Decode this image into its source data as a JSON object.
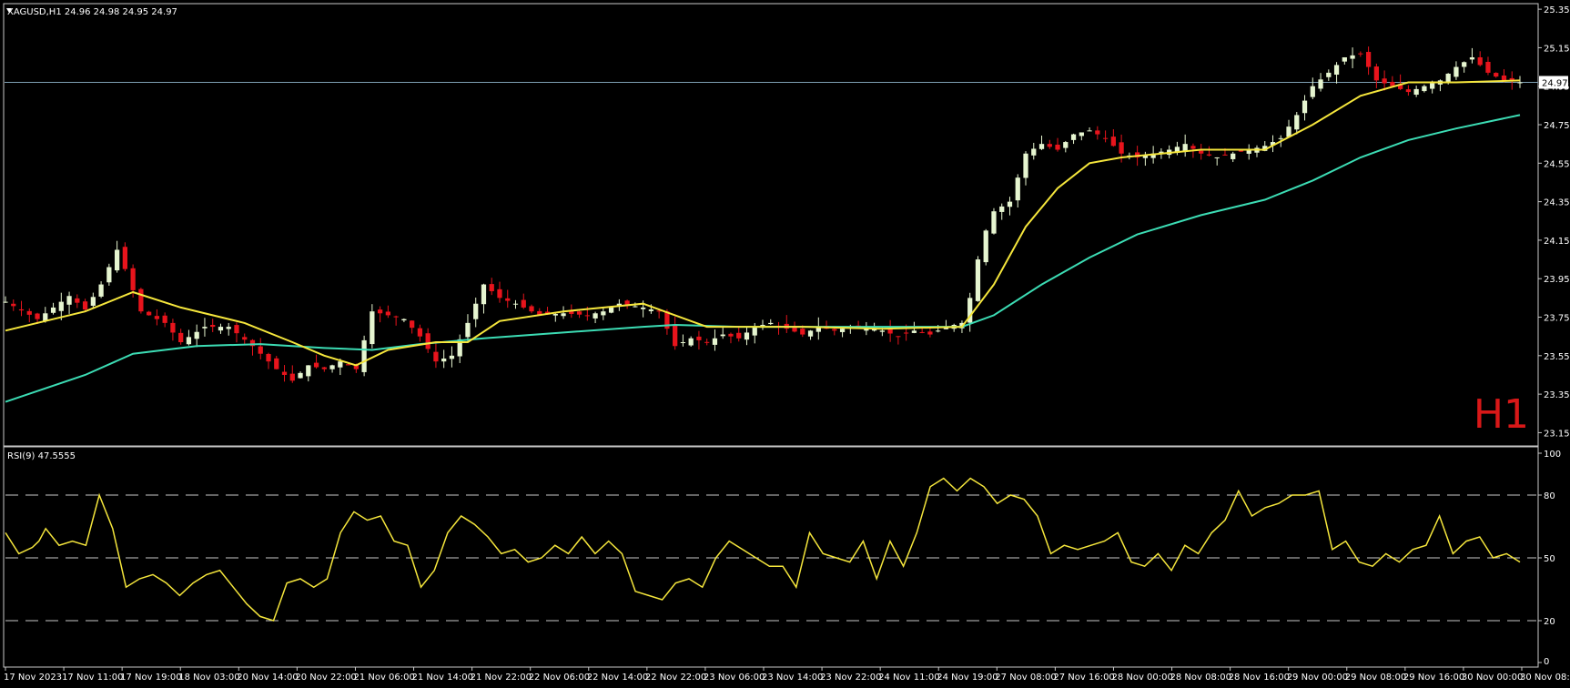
{
  "header": {
    "symbol_line": "XAGUSD,H1  24.96 24.98 24.95 24.97",
    "timeframe_watermark": "H1"
  },
  "colors": {
    "background": "#000000",
    "frame": "#c8c8c8",
    "bull_candle": "#e6f5d0",
    "bear_candle": "#e8141c",
    "ma_fast": "#f5e63c",
    "ma_slow": "#3cdcb4",
    "rsi_line": "#f5e63c",
    "last_price_line": "#7f9fb4"
  },
  "chart_data": [
    {
      "type": "candlestick",
      "symbol": "XAGUSD",
      "timeframe": "H1",
      "last_price_label": "24.97",
      "ylim": [
        23.1,
        25.36
      ],
      "y_ticks": [
        "25.35",
        "25.15",
        "24.95",
        "24.75",
        "24.55",
        "24.35",
        "24.15",
        "23.95",
        "23.75",
        "23.55",
        "23.35",
        "23.15"
      ],
      "x_ticks": [
        "17 Nov 2023",
        "17 Nov 11:00",
        "17 Nov 19:00",
        "18 Nov 03:00",
        "20 Nov 14:00",
        "20 Nov 22:00",
        "21 Nov 06:00",
        "21 Nov 14:00",
        "21 Nov 22:00",
        "22 Nov 06:00",
        "22 Nov 14:00",
        "22 Nov 22:00",
        "23 Nov 06:00",
        "23 Nov 14:00",
        "23 Nov 22:00",
        "24 Nov 11:00",
        "24 Nov 19:00",
        "27 Nov 08:00",
        "27 Nov 16:00",
        "28 Nov 00:00",
        "28 Nov 08:00",
        "28 Nov 16:00",
        "29 Nov 00:00",
        "29 Nov 08:00",
        "29 Nov 16:00",
        "30 Nov 00:00",
        "30 Nov 08:00"
      ],
      "close_path": [
        [
          0,
          23.83
        ],
        [
          4,
          23.74
        ],
        [
          6,
          23.8
        ],
        [
          8,
          23.86
        ],
        [
          10,
          23.79
        ],
        [
          12,
          23.92
        ],
        [
          14,
          24.1
        ],
        [
          15,
          24.0
        ],
        [
          17,
          23.78
        ],
        [
          20,
          23.72
        ],
        [
          22,
          23.62
        ],
        [
          25,
          23.7
        ],
        [
          28,
          23.7
        ],
        [
          31,
          23.6
        ],
        [
          34,
          23.48
        ],
        [
          36,
          23.42
        ],
        [
          38,
          23.5
        ],
        [
          40,
          23.48
        ],
        [
          42,
          23.52
        ],
        [
          44,
          23.48
        ],
        [
          46,
          23.78
        ],
        [
          48,
          23.76
        ],
        [
          50,
          23.74
        ],
        [
          52,
          23.65
        ],
        [
          54,
          23.52
        ],
        [
          56,
          23.55
        ],
        [
          58,
          23.72
        ],
        [
          60,
          23.92
        ],
        [
          62,
          23.85
        ],
        [
          64,
          23.82
        ],
        [
          67,
          23.76
        ],
        [
          70,
          23.77
        ],
        [
          73,
          23.76
        ],
        [
          75,
          23.78
        ],
        [
          77,
          23.82
        ],
        [
          80,
          23.8
        ],
        [
          82,
          23.78
        ],
        [
          84,
          23.6
        ],
        [
          86,
          23.64
        ],
        [
          88,
          23.62
        ],
        [
          90,
          23.66
        ],
        [
          92,
          23.64
        ],
        [
          94,
          23.7
        ],
        [
          96,
          23.72
        ],
        [
          98,
          23.69
        ],
        [
          100,
          23.66
        ],
        [
          102,
          23.7
        ],
        [
          104,
          23.68
        ],
        [
          106,
          23.7
        ],
        [
          108,
          23.7
        ],
        [
          110,
          23.68
        ],
        [
          112,
          23.65
        ],
        [
          114,
          23.68
        ],
        [
          116,
          23.66
        ],
        [
          118,
          23.7
        ],
        [
          120,
          23.72
        ],
        [
          121,
          23.85
        ],
        [
          122,
          24.05
        ],
        [
          123,
          24.2
        ],
        [
          124,
          24.3
        ],
        [
          126,
          24.35
        ],
        [
          128,
          24.6
        ],
        [
          130,
          24.65
        ],
        [
          132,
          24.62
        ],
        [
          134,
          24.7
        ],
        [
          136,
          24.72
        ],
        [
          138,
          24.68
        ],
        [
          140,
          24.6
        ],
        [
          142,
          24.58
        ],
        [
          144,
          24.6
        ],
        [
          146,
          24.62
        ],
        [
          148,
          24.65
        ],
        [
          150,
          24.6
        ],
        [
          152,
          24.58
        ],
        [
          154,
          24.6
        ],
        [
          156,
          24.62
        ],
        [
          158,
          24.64
        ],
        [
          160,
          24.68
        ],
        [
          162,
          24.8
        ],
        [
          164,
          24.95
        ],
        [
          166,
          25.02
        ],
        [
          168,
          25.1
        ],
        [
          170,
          25.12
        ],
        [
          172,
          24.98
        ],
        [
          174,
          24.95
        ],
        [
          176,
          24.92
        ],
        [
          178,
          24.95
        ],
        [
          180,
          24.98
        ],
        [
          182,
          25.05
        ],
        [
          184,
          25.1
        ],
        [
          186,
          25.02
        ],
        [
          188,
          24.98
        ],
        [
          190,
          24.97
        ]
      ],
      "ma_fast_path": [
        [
          0,
          23.68
        ],
        [
          10,
          23.78
        ],
        [
          16,
          23.88
        ],
        [
          22,
          23.8
        ],
        [
          30,
          23.72
        ],
        [
          36,
          23.62
        ],
        [
          40,
          23.55
        ],
        [
          44,
          23.5
        ],
        [
          48,
          23.58
        ],
        [
          54,
          23.62
        ],
        [
          58,
          23.62
        ],
        [
          62,
          23.73
        ],
        [
          70,
          23.78
        ],
        [
          80,
          23.82
        ],
        [
          84,
          23.76
        ],
        [
          88,
          23.7
        ],
        [
          100,
          23.7
        ],
        [
          110,
          23.69
        ],
        [
          120,
          23.7
        ],
        [
          124,
          23.92
        ],
        [
          128,
          24.22
        ],
        [
          132,
          24.42
        ],
        [
          136,
          24.55
        ],
        [
          140,
          24.58
        ],
        [
          150,
          24.62
        ],
        [
          158,
          24.62
        ],
        [
          164,
          24.75
        ],
        [
          170,
          24.9
        ],
        [
          176,
          24.97
        ],
        [
          182,
          24.97
        ],
        [
          190,
          24.98
        ]
      ],
      "ma_slow_path": [
        [
          0,
          23.31
        ],
        [
          10,
          23.45
        ],
        [
          16,
          23.56
        ],
        [
          24,
          23.6
        ],
        [
          32,
          23.61
        ],
        [
          40,
          23.59
        ],
        [
          46,
          23.58
        ],
        [
          52,
          23.61
        ],
        [
          60,
          23.64
        ],
        [
          70,
          23.67
        ],
        [
          80,
          23.7
        ],
        [
          84,
          23.71
        ],
        [
          92,
          23.7
        ],
        [
          100,
          23.7
        ],
        [
          110,
          23.7
        ],
        [
          120,
          23.7
        ],
        [
          124,
          23.76
        ],
        [
          130,
          23.92
        ],
        [
          136,
          24.06
        ],
        [
          142,
          24.18
        ],
        [
          150,
          24.28
        ],
        [
          158,
          24.36
        ],
        [
          164,
          24.46
        ],
        [
          170,
          24.58
        ],
        [
          176,
          24.67
        ],
        [
          182,
          24.73
        ],
        [
          190,
          24.8
        ]
      ]
    },
    {
      "type": "line",
      "indicator_label": "RSI(9) 47.5555",
      "ylim": [
        0,
        100
      ],
      "y_ticks": [
        "100",
        "80",
        "50",
        "20",
        "0"
      ],
      "levels": [
        80,
        50,
        20
      ],
      "values_path": [
        [
          0,
          62
        ],
        [
          2,
          52
        ],
        [
          4,
          55
        ],
        [
          5,
          58
        ],
        [
          6,
          64
        ],
        [
          8,
          56
        ],
        [
          10,
          58
        ],
        [
          12,
          56
        ],
        [
          14,
          80
        ],
        [
          16,
          64
        ],
        [
          18,
          36
        ],
        [
          20,
          40
        ],
        [
          22,
          42
        ],
        [
          24,
          38
        ],
        [
          26,
          32
        ],
        [
          28,
          38
        ],
        [
          30,
          42
        ],
        [
          32,
          44
        ],
        [
          34,
          36
        ],
        [
          36,
          28
        ],
        [
          38,
          22
        ],
        [
          40,
          20
        ],
        [
          42,
          38
        ],
        [
          44,
          40
        ],
        [
          46,
          36
        ],
        [
          48,
          40
        ],
        [
          50,
          62
        ],
        [
          52,
          72
        ],
        [
          54,
          68
        ],
        [
          56,
          70
        ],
        [
          58,
          58
        ],
        [
          60,
          56
        ],
        [
          62,
          36
        ],
        [
          64,
          44
        ],
        [
          66,
          62
        ],
        [
          68,
          70
        ],
        [
          70,
          66
        ],
        [
          72,
          60
        ],
        [
          74,
          52
        ],
        [
          76,
          54
        ],
        [
          78,
          48
        ],
        [
          80,
          50
        ],
        [
          82,
          56
        ],
        [
          84,
          52
        ],
        [
          86,
          60
        ],
        [
          88,
          52
        ],
        [
          90,
          58
        ],
        [
          92,
          52
        ],
        [
          94,
          34
        ],
        [
          96,
          32
        ],
        [
          98,
          30
        ],
        [
          100,
          38
        ],
        [
          102,
          40
        ],
        [
          104,
          36
        ],
        [
          106,
          50
        ],
        [
          108,
          58
        ],
        [
          110,
          54
        ],
        [
          112,
          50
        ],
        [
          114,
          46
        ],
        [
          116,
          46
        ],
        [
          118,
          36
        ],
        [
          120,
          62
        ],
        [
          122,
          52
        ],
        [
          124,
          50
        ],
        [
          126,
          48
        ],
        [
          128,
          58
        ],
        [
          130,
          40
        ],
        [
          132,
          58
        ],
        [
          134,
          46
        ],
        [
          136,
          62
        ],
        [
          138,
          84
        ],
        [
          140,
          88
        ],
        [
          142,
          82
        ],
        [
          144,
          88
        ],
        [
          146,
          84
        ],
        [
          148,
          76
        ],
        [
          150,
          80
        ],
        [
          152,
          78
        ],
        [
          154,
          70
        ],
        [
          156,
          52
        ],
        [
          158,
          56
        ],
        [
          160,
          54
        ],
        [
          162,
          56
        ],
        [
          164,
          58
        ],
        [
          166,
          62
        ],
        [
          168,
          48
        ],
        [
          170,
          46
        ],
        [
          172,
          52
        ],
        [
          174,
          44
        ],
        [
          176,
          56
        ],
        [
          178,
          52
        ],
        [
          180,
          62
        ],
        [
          182,
          68
        ],
        [
          184,
          82
        ],
        [
          186,
          70
        ],
        [
          188,
          74
        ],
        [
          190,
          76
        ],
        [
          192,
          80
        ],
        [
          194,
          80
        ],
        [
          196,
          82
        ],
        [
          198,
          54
        ],
        [
          200,
          58
        ],
        [
          202,
          48
        ],
        [
          204,
          46
        ],
        [
          206,
          52
        ],
        [
          208,
          48
        ],
        [
          210,
          54
        ],
        [
          212,
          56
        ],
        [
          214,
          70
        ],
        [
          216,
          52
        ],
        [
          218,
          58
        ],
        [
          220,
          60
        ],
        [
          222,
          50
        ],
        [
          224,
          52
        ],
        [
          226,
          48
        ]
      ]
    }
  ]
}
